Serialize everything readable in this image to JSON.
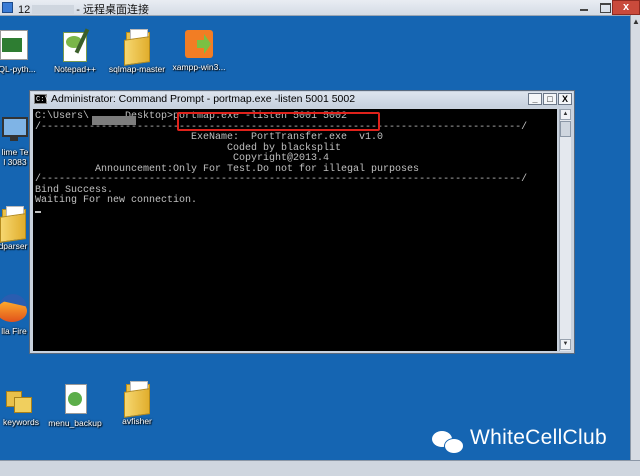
{
  "remote_desktop": {
    "title_prefix": "12",
    "title_suffix": "- 远程桌面连接",
    "close_glyph": "x"
  },
  "desktop_icons": [
    {
      "label": "QL-pyth...",
      "icon": "python-sql-icon"
    },
    {
      "label": "Notepad++",
      "icon": "notepad-plus-plus-icon"
    },
    {
      "label": "sqlmap-master",
      "icon": "folder-icon"
    },
    {
      "label": "xampp-win3...",
      "icon": "xampp-icon"
    },
    {
      "label": "lime Te",
      "icon": "monitor-icon"
    },
    {
      "label": "l 3083",
      "icon": "monitor-icon"
    },
    {
      "label": "dparser",
      "icon": "folder-icon"
    },
    {
      "label": "lla Fire",
      "icon": "firefox-icon"
    },
    {
      "label": "keywords",
      "icon": "folder-icon"
    },
    {
      "label": "menu_backup",
      "icon": "menu-backup-icon"
    },
    {
      "label": "avfisher",
      "icon": "folder-icon"
    }
  ],
  "cmd_window": {
    "title": "Administrator: Command Prompt - portmap.exe  -listen 5001 5002",
    "buttons": {
      "minimize": "_",
      "maximize": "□",
      "close": "X"
    },
    "prompt_prefix": "C:\\Users\\",
    "prompt_suffix": "Desktop>",
    "command": "portmap.exe -listen 5001 5002",
    "separator_top": "/--------------------------------------------------------------------------------/",
    "banner_lines": [
      "                          ExeName:  PortTransfer.exe  v1.0",
      "                                Coded by blacksplit",
      "                                 Copyright@2013.4",
      "          Announcement:Only For Test.Do not for illegal purposes"
    ],
    "separator_bottom": "/--------------------------------------------------------------------------------/",
    "output_lines": [
      "Bind Success.",
      "Waiting For new connection."
    ]
  },
  "watermark": {
    "text": "WhiteCellClub",
    "icon": "wechat-icon"
  }
}
